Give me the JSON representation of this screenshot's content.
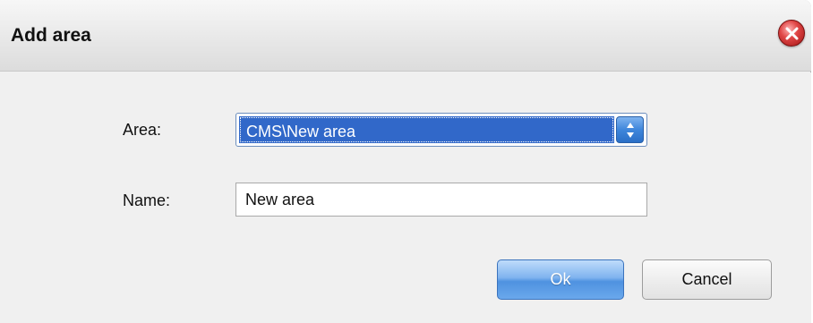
{
  "window": {
    "title": "Add area",
    "close_icon": "close-icon"
  },
  "form": {
    "area_label": "Area:",
    "area_value": "CMS\\New area",
    "name_label": "Name:",
    "name_value": "New area"
  },
  "buttons": {
    "ok_label": "Ok",
    "cancel_label": "Cancel"
  },
  "colors": {
    "selection": "#3168c9",
    "ok_button": "#4f92e0",
    "close_button": "#e04646"
  }
}
